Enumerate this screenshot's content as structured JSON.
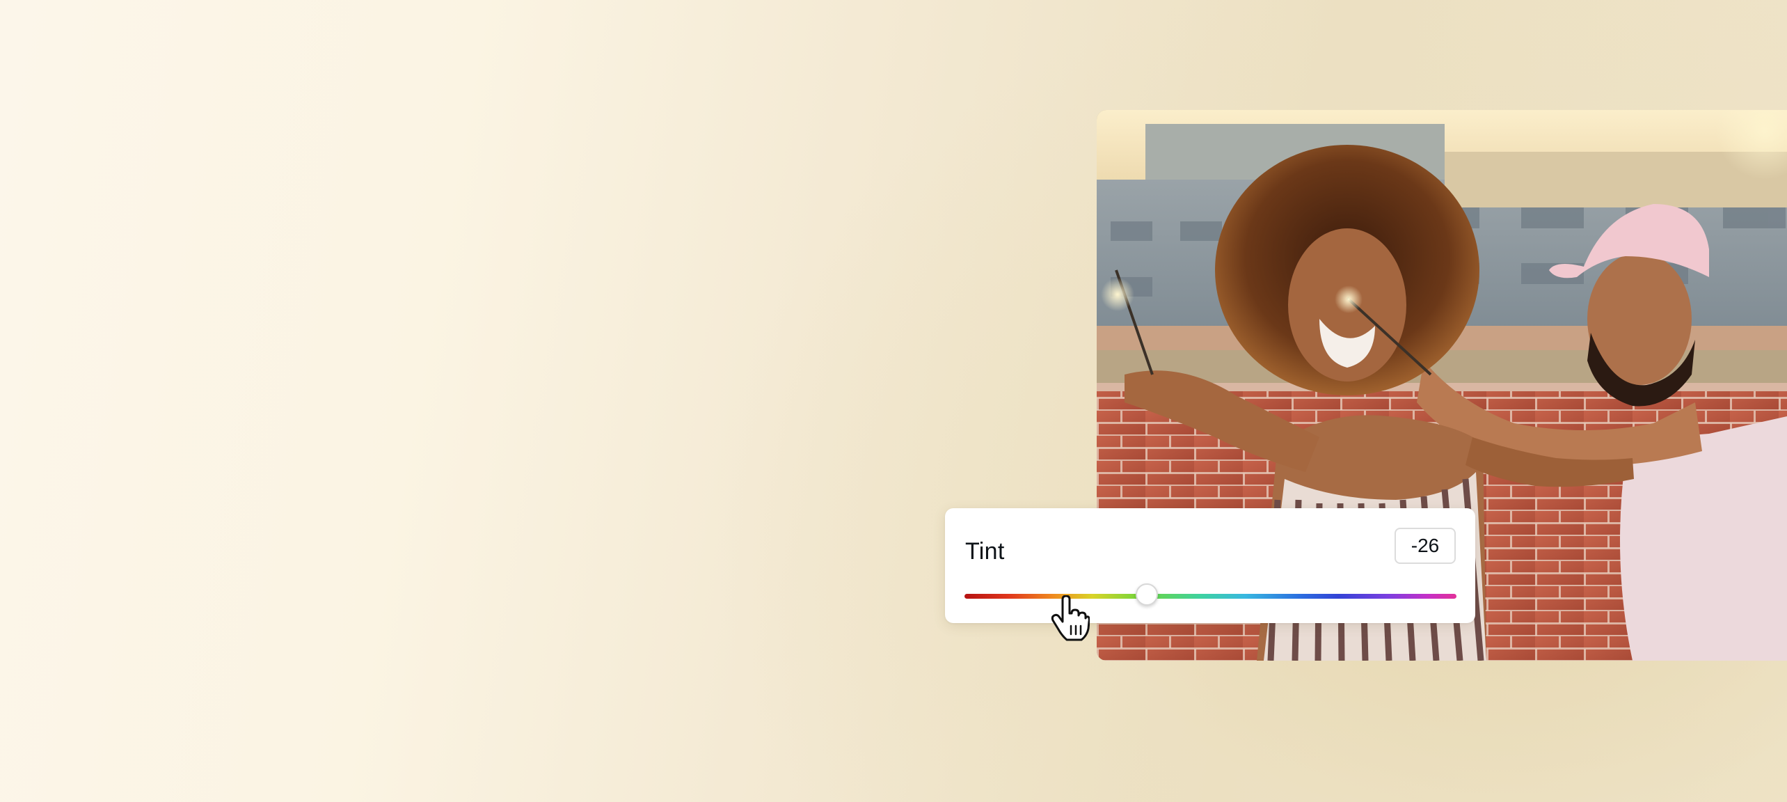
{
  "tint_panel": {
    "label": "Tint",
    "value": "-26",
    "slider": {
      "min": -100,
      "max": 100,
      "current": -26,
      "gradient_colors": [
        "#b51212",
        "#ef8a1f",
        "#d9d328",
        "#6fd63c",
        "#3ed2a0",
        "#38b8e0",
        "#3343d6",
        "#7b3fe0",
        "#e23199"
      ]
    }
  },
  "cursor": {
    "icon": "hand-pointer-icon"
  },
  "photo": {
    "palette": {
      "sky": "#f3e1b7",
      "building": "#8e99a1",
      "brick": "#b8543f",
      "hair": "#5a2f16",
      "skin": "#a4663f",
      "cap": "#f1c8cf",
      "shirt": "#ecd9dc"
    }
  }
}
